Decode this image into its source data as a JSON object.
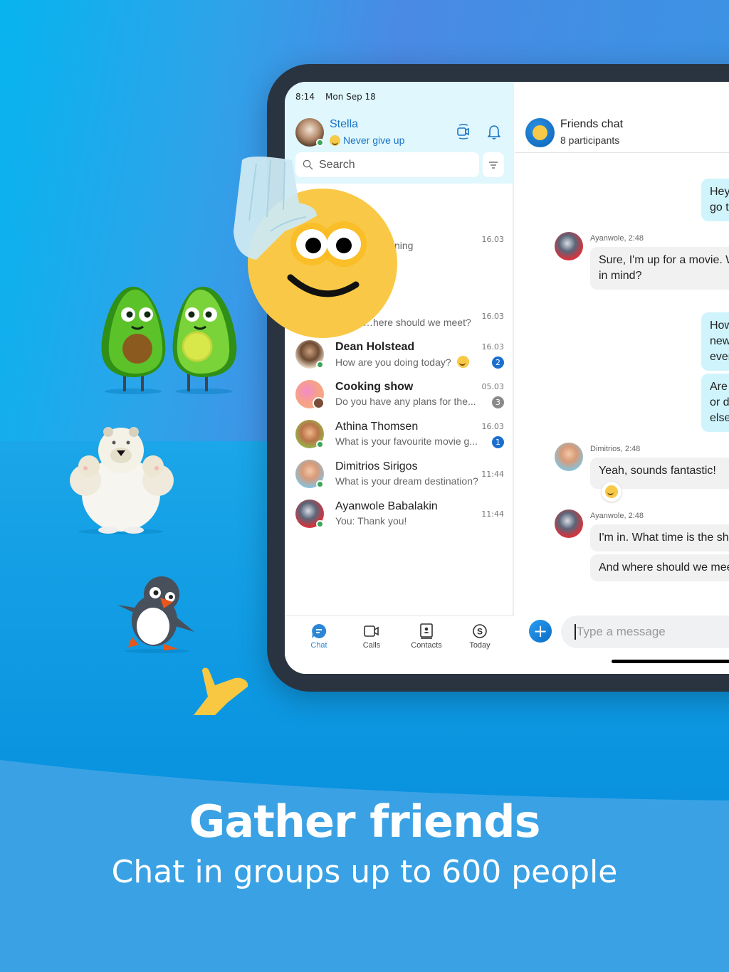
{
  "status_bar": {
    "time": "8:14",
    "date": "Mon Sep 18"
  },
  "profile": {
    "name": "Stella",
    "mood": "Never give up",
    "presence": "online"
  },
  "header_icons": [
    "video-call-icon",
    "bell-icon"
  ],
  "search": {
    "placeholder": "Search"
  },
  "chats": [
    {
      "name": "",
      "preview": "…ning",
      "time": "16.03",
      "unread": false,
      "badge": null,
      "obscured": true
    },
    {
      "name": "",
      "preview": "…here should we meet?",
      "time": "16.03",
      "unread": false,
      "badge": null,
      "obscured": true
    },
    {
      "name": "Dean Holstead",
      "preview": "How are you doing today?",
      "time": "16.03",
      "unread": true,
      "badge": "2",
      "badge_color": "#1a6fcf",
      "has_emoji": true
    },
    {
      "name": "Cooking show",
      "preview": "Do you have any plans for the...",
      "time": "05.03",
      "unread": true,
      "badge": "3",
      "badge_color": "#8a8a8a"
    },
    {
      "name": "Athina Thomsen",
      "preview": "What is your favourite movie g...",
      "time": "16.03",
      "unread": false,
      "badge": "1",
      "badge_color": "#1a6fcf"
    },
    {
      "name": "Dimitrios Sirigos",
      "preview": "What is your dream destination?",
      "time": "11:44",
      "unread": false,
      "badge": null
    },
    {
      "name": "Ayanwole Babalakin",
      "preview": "You: Thank you!",
      "time": "11:44",
      "unread": false,
      "badge": null
    }
  ],
  "nav": [
    {
      "label": "Chat",
      "icon": "chat-icon",
      "active": true
    },
    {
      "label": "Calls",
      "icon": "video-icon",
      "active": false
    },
    {
      "label": "Contacts",
      "icon": "contacts-icon",
      "active": false
    },
    {
      "label": "Today",
      "icon": "skype-icon",
      "active": false
    }
  ],
  "conversation": {
    "title": "Friends chat",
    "subtitle": "8 participants",
    "messages": [
      {
        "direction": "out",
        "lines": [
          "Hey",
          "go t"
        ]
      },
      {
        "direction": "in",
        "sender": "Ayanwole, 2:48",
        "lines": [
          "Sure, I'm up for a movie. W",
          "in mind?"
        ]
      },
      {
        "direction": "out",
        "lines": [
          "How",
          "new",
          "ever"
        ]
      },
      {
        "direction": "out",
        "lines": [
          "Are",
          "or d",
          "else"
        ]
      },
      {
        "direction": "in",
        "sender": "Dimitrios, 2:48",
        "lines": [
          "Yeah, sounds fantastic!"
        ],
        "reaction": "smile"
      },
      {
        "direction": "in",
        "sender": "Ayanwole, 2:48",
        "lines": [
          "I'm in. What time is the sh"
        ]
      },
      {
        "direction": "in",
        "lines": [
          "And where should we mee"
        ]
      }
    ],
    "input_placeholder": "Type a message"
  },
  "marketing": {
    "headline": "Gather friends",
    "subheadline": "Chat in groups up to 600 people"
  },
  "colors": {
    "accent": "#1a73c7",
    "header_bg": "#dff7fd",
    "out_bubble": "#cff4fc",
    "in_bubble": "#f1f1f1",
    "device_frame": "#2a3441"
  }
}
